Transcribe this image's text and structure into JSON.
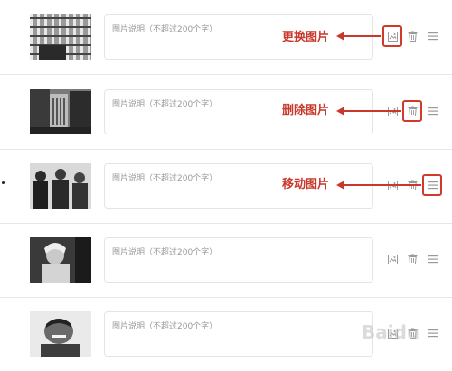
{
  "caption_placeholder": "图片说明（不超过200个字）",
  "rows": [
    {
      "annotation": "更换图片",
      "highlight": "replace"
    },
    {
      "annotation": "删除图片",
      "highlight": "delete"
    },
    {
      "annotation": "移动图片",
      "highlight": "move"
    },
    {
      "annotation": "",
      "highlight": ""
    },
    {
      "annotation": "",
      "highlight": ""
    }
  ],
  "icons": {
    "replace": "image-replace-icon",
    "delete": "trash-icon",
    "move": "drag-handle-icon"
  },
  "colors": {
    "annotation": "#c8392b",
    "border": "#e4e4e4",
    "placeholder": "#9a9a9a"
  },
  "watermark": "Baidu"
}
